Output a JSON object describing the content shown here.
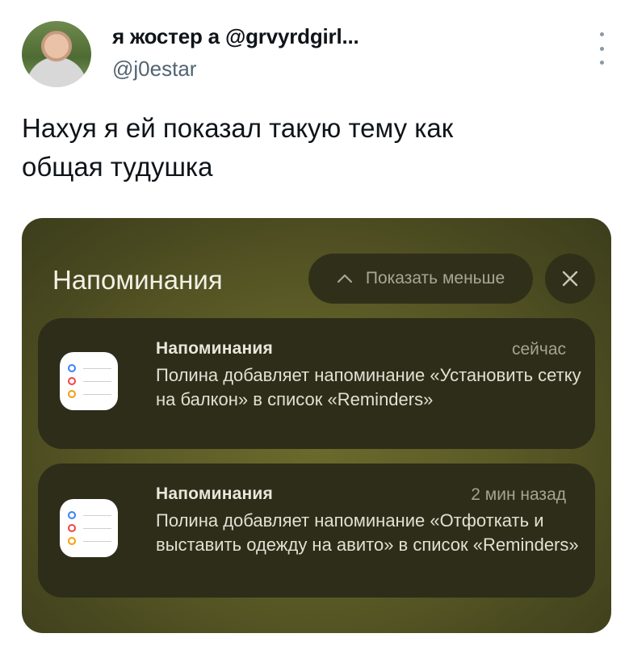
{
  "tweet": {
    "display_name": "я жостер а @grvyrdgirl...",
    "handle": "@j0estar",
    "text": "Нахуя я ей показал такую тему как\nобщая тудушка"
  },
  "screenshot": {
    "section_title": "Напоминания",
    "show_less_label": "Показать меньше",
    "notifications": [
      {
        "app": "Напоминания",
        "time": "сейчас",
        "body": "Полина добавляет напоминание «Установить сетку на балкон» в список «Reminders»"
      },
      {
        "app": "Напоминания",
        "time": "2 мин назад",
        "body": "Полина добавляет напоминание «Отфоткать и выставить одежду на авито» в список «Reminders»"
      }
    ]
  },
  "colors": {
    "reminder_dot_blue": "#3b82f6",
    "reminder_dot_red": "#ef4444",
    "reminder_dot_orange": "#f59e0b"
  }
}
